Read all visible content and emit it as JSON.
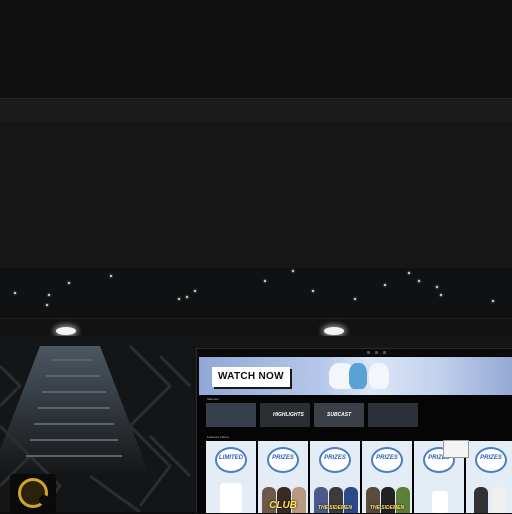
{
  "scene": {
    "description_free": true,
    "monitor": {
      "hero_button": "WATCH NOW",
      "row1_label": "Sidemen",
      "row2_label": "Featured Videos",
      "videos": [
        {
          "title": "",
          "sub": ""
        },
        {
          "title": "HIGHLIGHTS",
          "sub": ""
        },
        {
          "title": "SUBCAST",
          "sub": ""
        },
        {
          "title": "",
          "sub": ""
        }
      ],
      "cards": [
        {
          "badge": "LIMITED",
          "caption": "",
          "big": false
        },
        {
          "badge": "PRIZES",
          "caption": "CLUB",
          "big": true
        },
        {
          "badge": "PRIZES",
          "caption": "THE SIDEMEN",
          "big": false
        },
        {
          "badge": "PRIZES",
          "caption": "THE SIDEMEN",
          "big": false
        },
        {
          "badge": "PRIZES",
          "caption": "",
          "big": false
        },
        {
          "badge": "PRIZES",
          "caption": "",
          "big": false
        }
      ]
    },
    "colors": {
      "accent_blue": "#2c62ad",
      "caption_yellow": "#ffe455",
      "speaker_ring": "#cfa52a"
    }
  }
}
